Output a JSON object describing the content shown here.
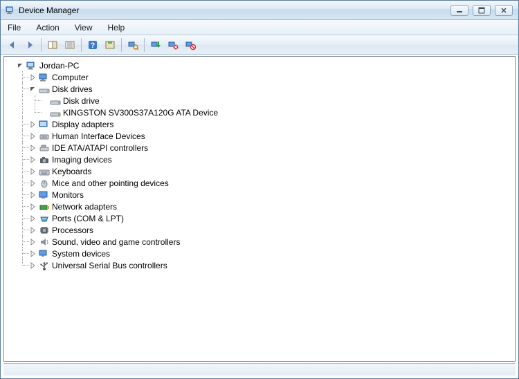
{
  "window": {
    "title": "Device Manager"
  },
  "menu": {
    "file": "File",
    "action": "Action",
    "view": "View",
    "help": "Help"
  },
  "toolbar": {
    "back": "Back",
    "forward": "Forward",
    "up": "Up containers",
    "show_hide": "Show/Hide Console Tree",
    "properties": "Properties",
    "help": "Help",
    "show_hidden": "Show hidden devices",
    "scan": "Scan for hardware changes",
    "update": "Update driver",
    "uninstall": "Uninstall",
    "disable": "Disable"
  },
  "tree": {
    "root": "Jordan-PC",
    "computer": "Computer",
    "disk_drives": "Disk drives",
    "disk_drive_item": "Disk drive",
    "kingston": "KINGSTON SV300S37A120G ATA Device",
    "display_adapters": "Display adapters",
    "hid": "Human Interface Devices",
    "ide": "IDE ATA/ATAPI controllers",
    "imaging": "Imaging devices",
    "keyboards": "Keyboards",
    "mice": "Mice and other pointing devices",
    "monitors": "Monitors",
    "network": "Network adapters",
    "ports": "Ports (COM & LPT)",
    "processors": "Processors",
    "sound": "Sound, video and game controllers",
    "system": "System devices",
    "usb": "Universal Serial Bus controllers"
  }
}
